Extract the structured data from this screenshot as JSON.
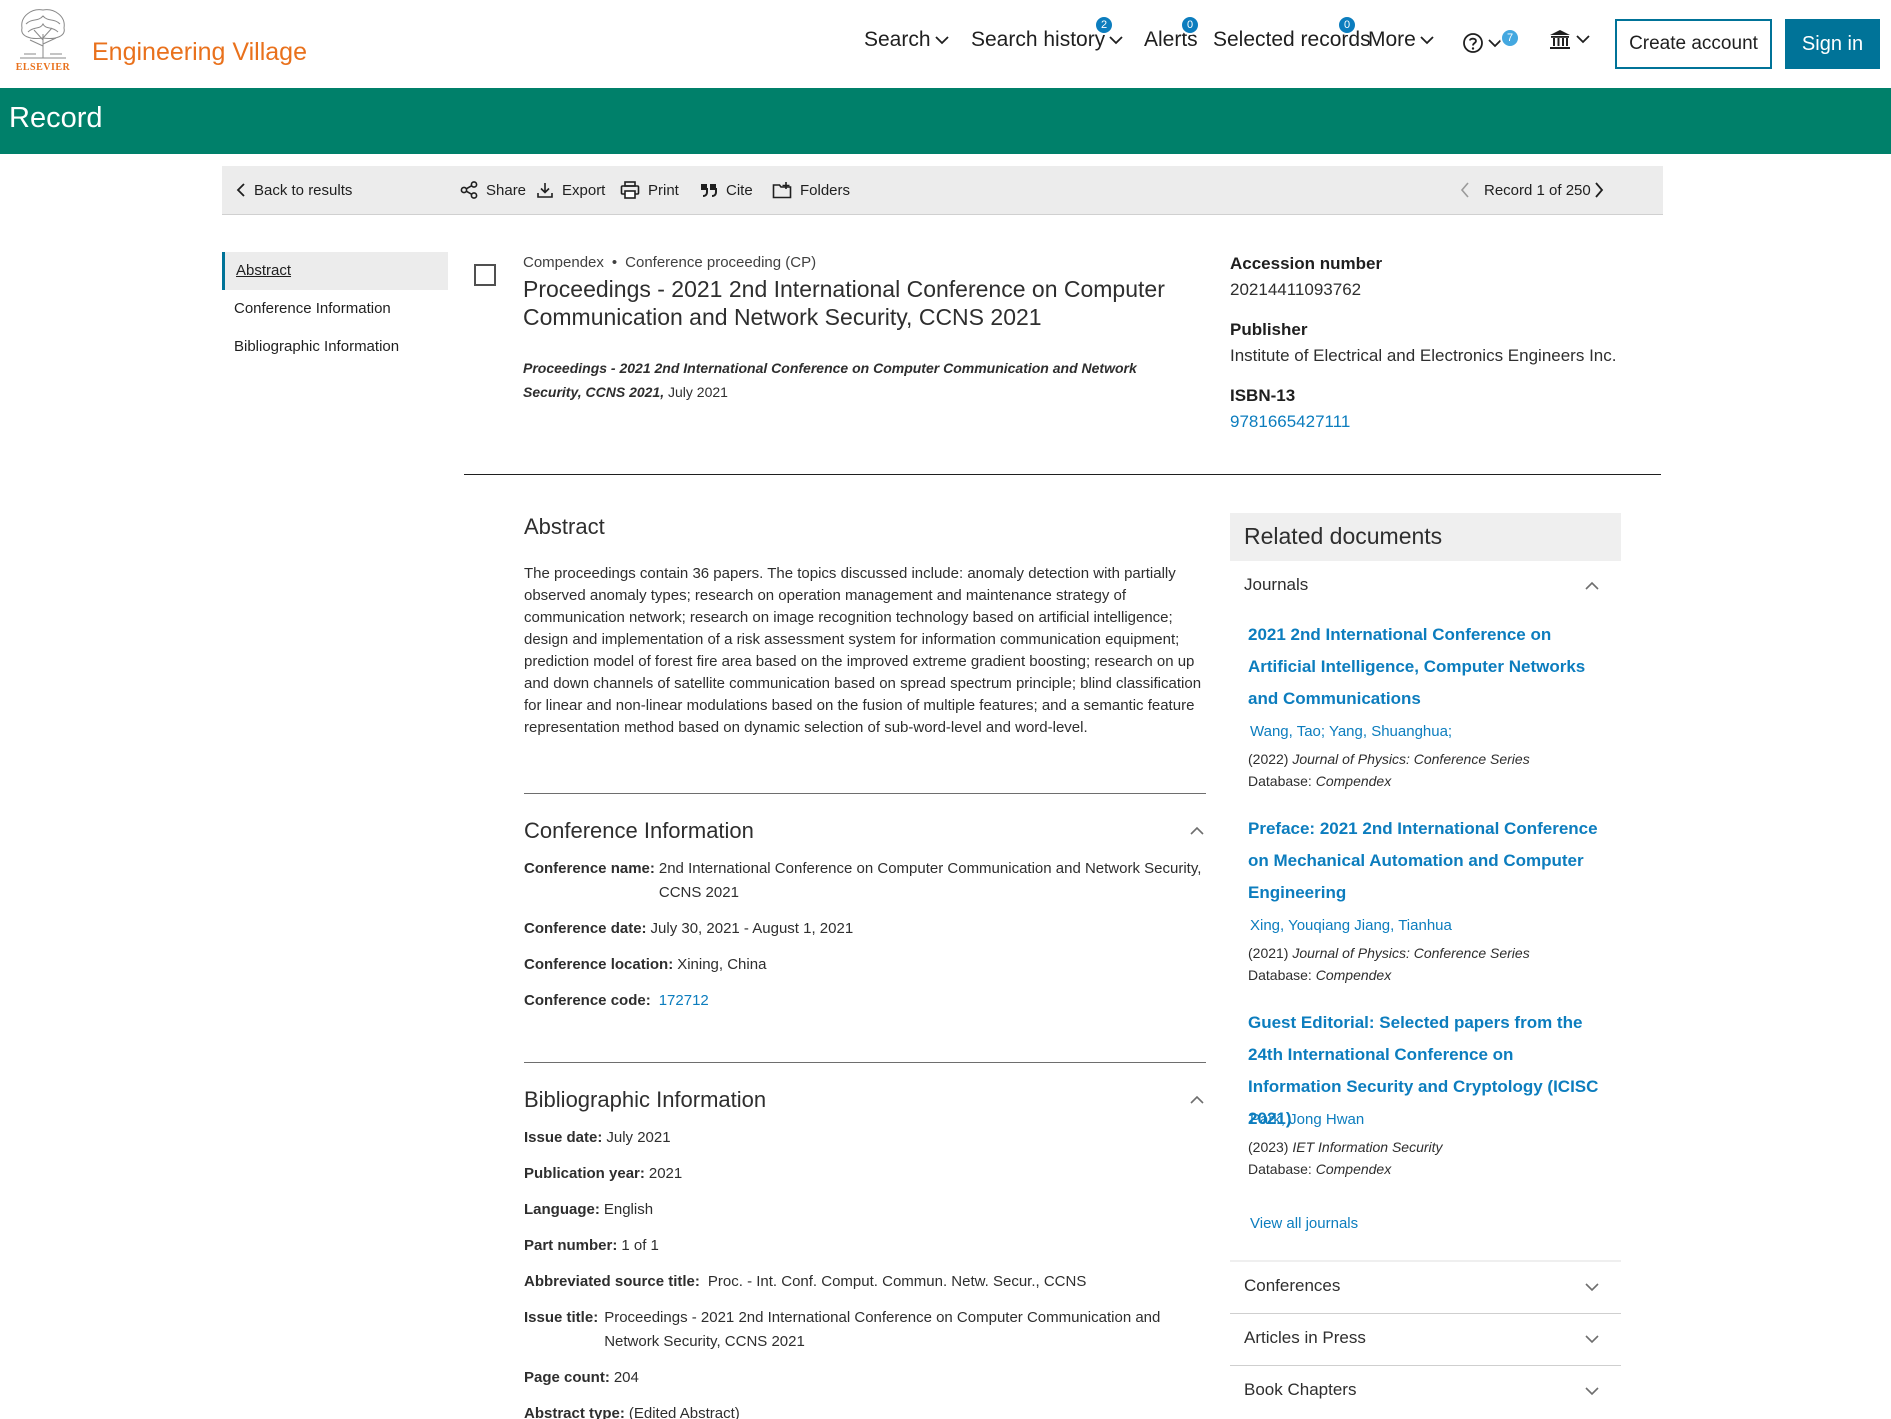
{
  "brand": {
    "logo_text": "ELSEVIER",
    "name": "Engineering Village"
  },
  "nav": {
    "search": "Search",
    "search_history": "Search history",
    "search_history_badge": "2",
    "alerts": "Alerts",
    "alerts_badge": "0",
    "selected_records": "Selected records",
    "selected_records_badge": "0",
    "more": "More",
    "help_badge": "7",
    "create_account": "Create account",
    "sign_in": "Sign in"
  },
  "page_title": "Record",
  "toolbar": {
    "back": "Back to results",
    "share": "Share",
    "export": "Export",
    "print": "Print",
    "cite": "Cite",
    "folders": "Folders",
    "record_position": "Record 1 of 250"
  },
  "left_nav": {
    "abstract": "Abstract",
    "conference": "Conference Information",
    "bibliographic": "Bibliographic Information"
  },
  "record": {
    "database": "Compendex",
    "doc_type": "Conference proceeding (CP)",
    "title": "Proceedings - 2021 2nd International Conference on Computer Communication and Network Security, CCNS 2021",
    "source_title": "Proceedings - 2021 2nd International Conference on Computer Communication and Network Security, CCNS 2021,",
    "source_date": "July 2021",
    "accession_label": "Accession number",
    "accession_value": "20214411093762",
    "publisher_label": "Publisher",
    "publisher_value": "Institute of Electrical and Electronics Engineers Inc.",
    "isbn_label": "ISBN-13",
    "isbn_value": "9781665427111"
  },
  "abstract": {
    "heading": "Abstract",
    "text": "The proceedings contain 36 papers. The topics discussed include: anomaly detection with partially observed anomaly types; research on operation management and maintenance strategy of communication network; research on image recognition technology based on artificial intelligence; design and implementation of a risk assessment system for information communication equipment; prediction model of forest fire area based on the improved extreme gradient boosting; research on up and down channels of satellite communication based on spread spectrum principle; blind classification for linear and non-linear modulations based on the fusion of multiple features; and a semantic feature representation method based on dynamic selection of sub-word-level and word-level."
  },
  "conference_info": {
    "heading": "Conference Information",
    "name_label": "Conference name:",
    "name_value": "2nd International Conference on Computer Communication and Network Security, CCNS 2021",
    "date_label": "Conference date:",
    "date_value": "July 30, 2021 - August 1, 2021",
    "location_label": "Conference location:",
    "location_value": "Xining, China",
    "code_label": "Conference code:",
    "code_value": "172712"
  },
  "bibliographic": {
    "heading": "Bibliographic Information",
    "issue_date_label": "Issue date:",
    "issue_date_value": "July 2021",
    "pub_year_label": "Publication year:",
    "pub_year_value": "2021",
    "language_label": "Language:",
    "language_value": "English",
    "part_label": "Part number:",
    "part_value": "1 of 1",
    "abbr_label": "Abbreviated source title:",
    "abbr_value": "Proc. - Int. Conf. Comput. Commun. Netw. Secur., CCNS",
    "issue_title_label": "Issue title:",
    "issue_title_value": "Proceedings - 2021 2nd International Conference on Computer Communication and Network Security, CCNS 2021",
    "page_count_label": "Page count:",
    "page_count_value": "204",
    "abstract_type_label": "Abstract type:",
    "abstract_type_value": "(Edited Abstract)"
  },
  "related": {
    "heading": "Related documents",
    "journals_label": "Journals",
    "docs": [
      {
        "title": "2021 2nd International Conference on Artificial Intelligence, Computer Networks and Communications",
        "authors": "Wang, Tao; Yang, Shuanghua;",
        "year": "(2022)",
        "journal": "Journal of Physics: Conference Series",
        "db_label": "Database:",
        "db": "Compendex"
      },
      {
        "title": "Preface: 2021 2nd International Conference on Mechanical Automation and Computer Engineering",
        "authors": "Xing, Youqiang Jiang, Tianhua",
        "year": "(2021)",
        "journal": "Journal of Physics: Conference Series",
        "db_label": "Database:",
        "db": "Compendex"
      },
      {
        "title": "Guest Editorial: Selected papers from the 24th International Conference on Information Security and Cryptology (ICISC 2021)",
        "authors": "Park, Jong Hwan",
        "year": "(2023)",
        "journal": "IET Information Security",
        "db_label": "Database:",
        "db": "Compendex"
      }
    ],
    "view_all": "View all journals",
    "conferences": "Conferences",
    "articles_in_press": "Articles in Press",
    "book_chapters": "Book Chapters"
  },
  "colors": {
    "accent": "#007398",
    "band": "#00806a",
    "brand_orange": "#e9711c",
    "link": "#0c7dbe"
  }
}
